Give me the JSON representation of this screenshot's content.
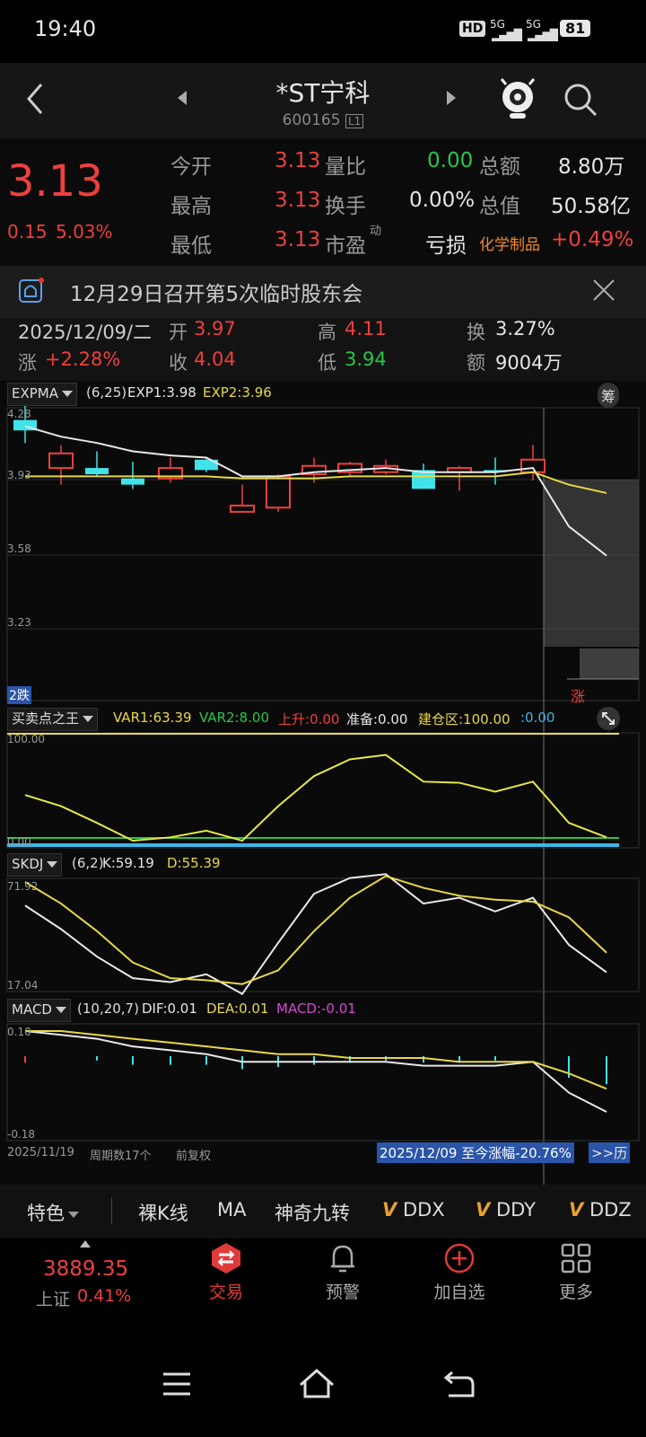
{
  "status": {
    "time": "19:40",
    "hd": "HD",
    "sig1": "5G",
    "sig2": "5G",
    "battery": "81"
  },
  "header": {
    "title": "*ST宁科",
    "code": "600165",
    "code_badge": "L1"
  },
  "quote": {
    "price": "3.13",
    "change": "0.15",
    "change_pct": "5.03%",
    "rows": [
      {
        "l1": "今开",
        "v1": "3.13",
        "l2": "量比",
        "v2": "0.00",
        "l3": "总额",
        "v3": "8.80万"
      },
      {
        "l1": "最高",
        "v1": "3.13",
        "l2": "换手",
        "v2": "0.00%",
        "l3": "总值",
        "v3": "50.58亿"
      },
      {
        "l1": "最低",
        "v1": "3.13",
        "l2": "市盈",
        "l2_sup": "动",
        "v2": "亏损",
        "l3": "化学制品",
        "v3": "+0.49%"
      }
    ]
  },
  "notice": {
    "text": "12月29日召开第5次临时股东会"
  },
  "day": {
    "date": "2025/12/09/二",
    "open_label": "开",
    "open": "3.97",
    "high_label": "高",
    "high": "4.11",
    "turn_label": "换",
    "turn": "3.27%",
    "chg_label": "涨",
    "chg": "+2.28%",
    "close_label": "收",
    "close": "4.04",
    "low_label": "低",
    "low": "3.94",
    "amt_label": "额",
    "amt": "9004万"
  },
  "chart1": {
    "name": "EXPMA",
    "params": "(6,25)",
    "exp1": "EXP1:3.98",
    "exp2": "EXP2:3.96",
    "chip": "筹",
    "y_labels": [
      "4.28",
      "3.93",
      "3.58",
      "3.23"
    ],
    "fall_tag": "2跌",
    "rise_tag": "涨"
  },
  "chart2": {
    "name": "买卖点之王",
    "var1": "VAR1:63.39",
    "var2": "VAR2:8.00",
    "up": "上升:0.00",
    "ready": "准备:0.00",
    "build": "建仓区:100.00",
    "zero": ":0.00",
    "y_labels": [
      "100.00",
      "0.00"
    ]
  },
  "chart3": {
    "name": "SKDJ",
    "params": "(6,2)",
    "k": "K:59.19",
    "d": "D:55.39",
    "y_labels": [
      "71.92",
      "17.04"
    ]
  },
  "chart4": {
    "name": "MACD",
    "params": "(10,20,7)",
    "dif": "DIF:0.01",
    "dea": "DEA:0.01",
    "macd": "MACD:-0.01",
    "y_labels": [
      "0.10",
      "-0.18"
    ]
  },
  "footer": {
    "start": "2025/11/19",
    "period": "周期数17个",
    "adjust": "前复权",
    "range": "2025/12/09 至今涨幅-20.76%",
    "history": ">>历"
  },
  "toolbar": {
    "feature": "特色",
    "items": [
      "裸K线",
      "MA",
      "神奇九转"
    ],
    "v_items": [
      "DDX",
      "DDY",
      "DDZ"
    ]
  },
  "bottomnav": {
    "index_value": "3889.35",
    "index_name": "上证",
    "index_pct": "0.41%",
    "items": [
      "交易",
      "预警",
      "加自选",
      "更多"
    ]
  },
  "colors": {
    "red": "#ee3f3f",
    "green": "#27c64a",
    "yellow": "#e8d846",
    "cyan": "#3fe3e8",
    "white": "#e8e8e8"
  }
}
